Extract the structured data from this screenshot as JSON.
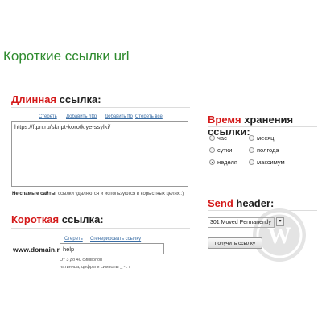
{
  "page": {
    "title": "Короткие ссылки url"
  },
  "long_link": {
    "title_accent": "Длинная",
    "title_rest": " ссылка:",
    "links": [
      "Стереть",
      "Добавить http",
      "Добавить ftp",
      "Стереть все"
    ],
    "value": "https://ftpn.ru/skript-korotkiye-ssylki/",
    "warning_bold": "Не спамьте сайты",
    "warning_rest": ", ссылки удаляются и используются в корыстных целях :)"
  },
  "short_link": {
    "title_accent": "Короткая",
    "title_rest": " ссылка:",
    "links": [
      "Стереть",
      "Сгенерировать ссылку"
    ],
    "domain": "www.domain.ru/",
    "value": "help",
    "hint_line1": "От 3 до 40 символов",
    "hint_line2": "латиница, цифры и символы _ - . /"
  },
  "storage": {
    "title_accent": "Время",
    "title_rest": " хранения ссылки:",
    "options": [
      {
        "label": "час",
        "checked": false
      },
      {
        "label": "месяц",
        "checked": false
      },
      {
        "label": "сутки",
        "checked": false
      },
      {
        "label": "полгода",
        "checked": false
      },
      {
        "label": "неделя",
        "checked": true
      },
      {
        "label": "максимум",
        "checked": false
      }
    ]
  },
  "header": {
    "title_accent": "Send",
    "title_rest": " header:",
    "selected": "301 Moved Permanently",
    "arrow": "▾",
    "button": "получить ссылку"
  },
  "colors": {
    "accent_red": "#d41a1a",
    "title_green": "#2e8b2e",
    "link_blue": "#3b6ea5"
  },
  "watermark": {
    "icon": "wordpress-logo"
  }
}
